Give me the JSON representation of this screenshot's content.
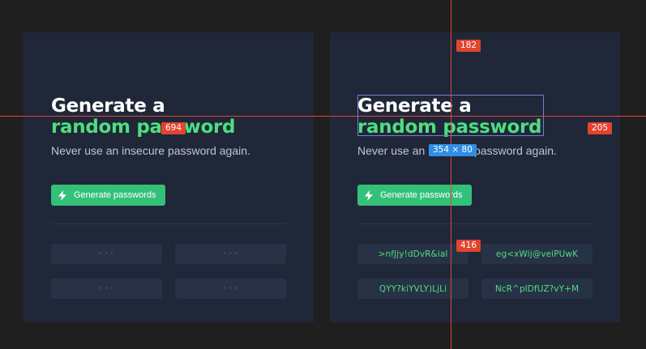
{
  "panels": [
    {
      "title_line1": "Generate a",
      "title_line2": "random password",
      "subtitle": "Never use an insecure password again.",
      "button_label": "Generate passwords",
      "passwords": [
        "•••",
        "•••",
        "•••",
        "•••"
      ]
    },
    {
      "title_line1": "Generate a",
      "title_line2": "random password",
      "subtitle": "Never use an insecure password again.",
      "button_label": "Generate passwords",
      "passwords": [
        ">nfJjy!dDvR&ial",
        "eg<xWij@veiPUwK",
        "QYY?kiYVLY)LjLi",
        "NcR^plDfUZ?vY+M"
      ]
    }
  ],
  "inspector": {
    "badge_top": "182",
    "badge_left": "694",
    "badge_right": "205",
    "badge_bottom": "416",
    "size_label": "354 × 80"
  },
  "colors": {
    "background": "#1f1f1f",
    "panel": "#1f2738",
    "accent_green": "#4ede7f",
    "button": "#33c17a",
    "guide": "#e2452f",
    "selection": "#7b7ad6",
    "size_badge": "#2f8fe6"
  },
  "icons": {
    "button_icon": "lightning-bolt-icon"
  }
}
